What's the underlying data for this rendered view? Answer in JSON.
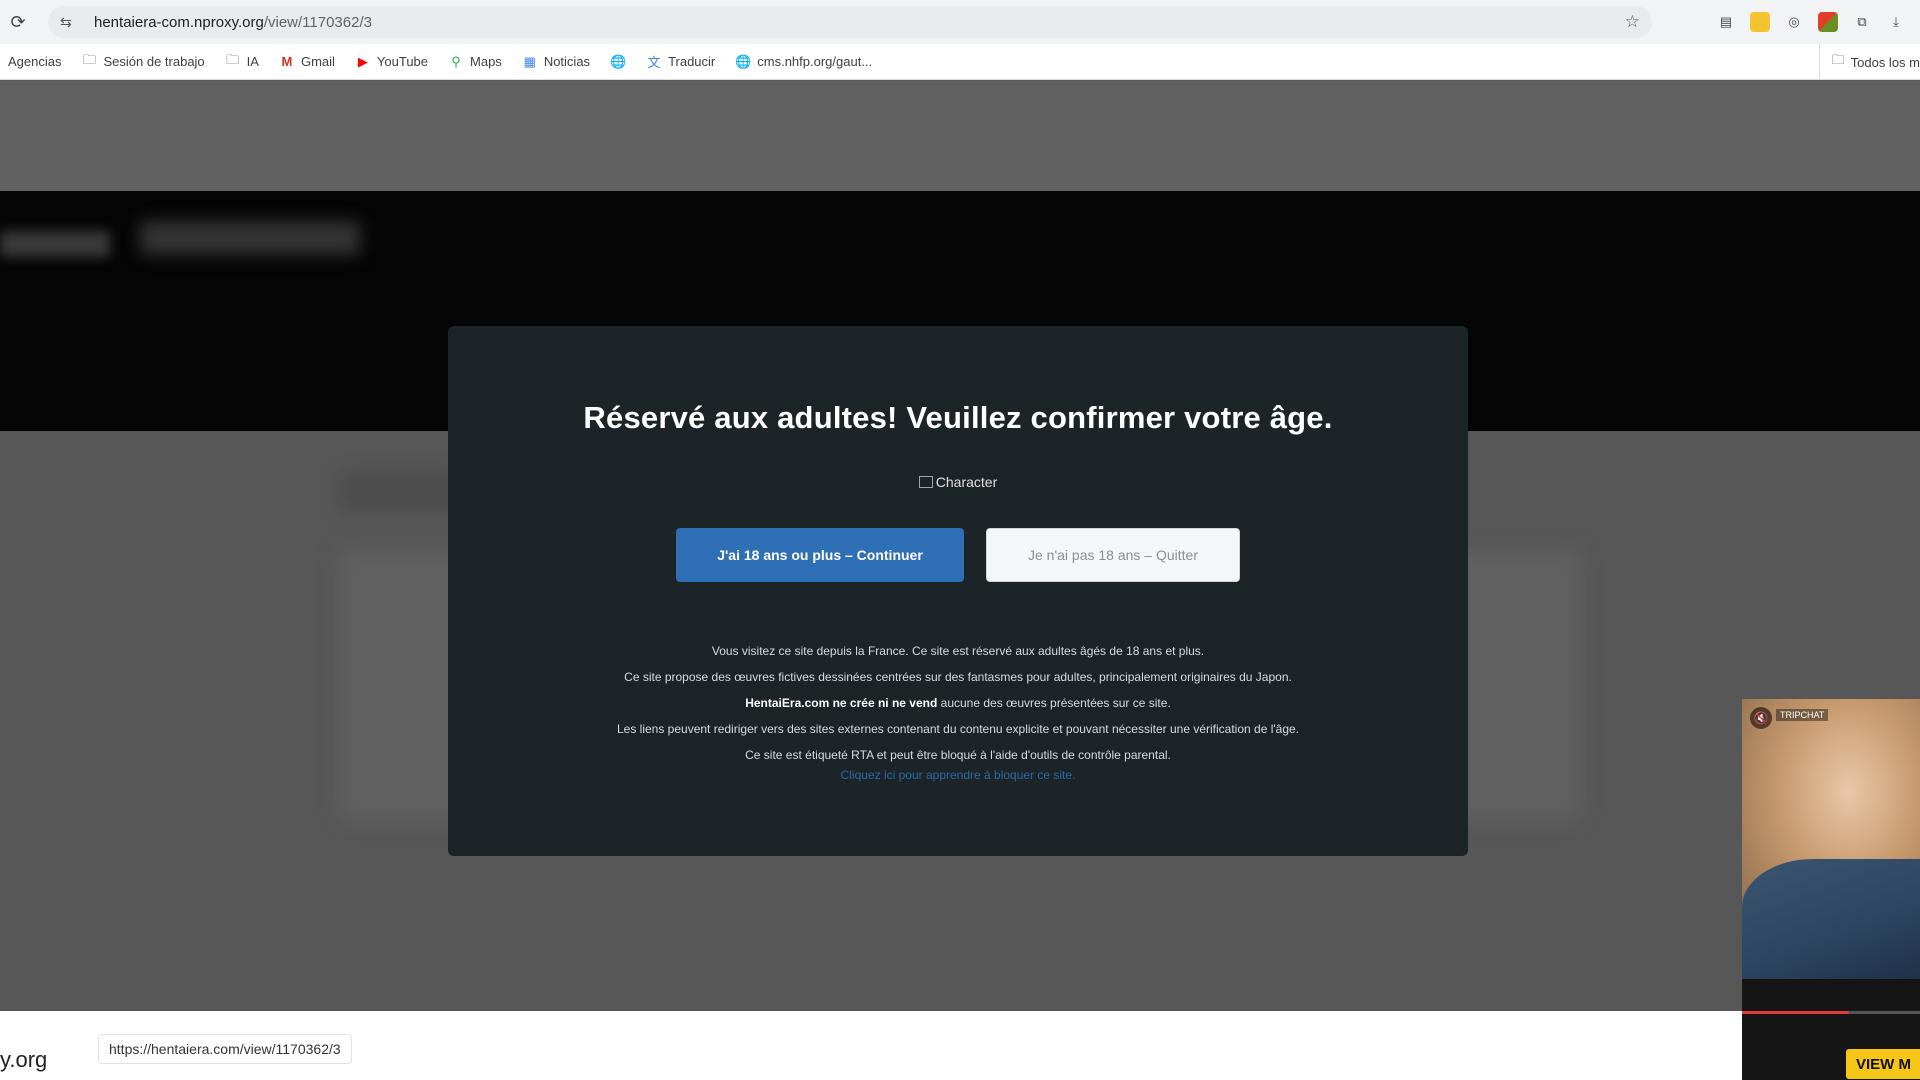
{
  "browser": {
    "url_host": "hentaiera-com.nproxy.org",
    "url_path": "/view/1170362/3",
    "bookmarks": [
      {
        "icon": "folder-icon",
        "label": "Agencias"
      },
      {
        "icon": "folder-icon",
        "label": "Sesión de trabajo"
      },
      {
        "icon": "folder-icon",
        "label": "IA"
      },
      {
        "icon": "gmail-icon",
        "label": "Gmail"
      },
      {
        "icon": "youtube-icon",
        "label": "YouTube"
      },
      {
        "icon": "maps-icon",
        "label": "Maps"
      },
      {
        "icon": "news-icon",
        "label": "Noticias"
      },
      {
        "icon": "globe-icon",
        "label": ""
      },
      {
        "icon": "translate-icon",
        "label": "Traducir"
      },
      {
        "icon": "globe-icon",
        "label": "cms.nhfp.org/gaut..."
      }
    ],
    "bookmarks_right": "Todos los m"
  },
  "modal": {
    "title": "Réservé aux adultes!  Veuillez confirmer votre âge.",
    "image_alt": "Character",
    "continue_label": "J'ai 18 ans ou plus – Continuer",
    "quit_label": "Je n'ai pas 18 ans – Quitter",
    "line1": "Vous visitez ce site depuis la France. Ce site est réservé aux adultes âgés de 18 ans et plus.",
    "line2": "Ce site propose des œuvres fictives dessinées centrées sur des fantasmes pour adultes, principalement originaires du Japon.",
    "line3_brand": "HentaiEra.com",
    "line3_bold": "ne crée ni ne vend",
    "line3_rest": "aucune des œuvres présentées sur ce site.",
    "line4": "Les liens peuvent rediriger vers des sites externes contenant du contenu explicite et pouvant nécessiter une vérification de l'âge.",
    "line5": "Ce site est étiqueté RTA et peut être bloqué à l'aide d'outils de contrôle parental.",
    "link": "Cliquez ici pour apprendre à bloquer ce site."
  },
  "ad": {
    "brand": "TRIPCHAT",
    "view_label": "VIEW M",
    "progress": 0.6
  },
  "status": {
    "domain_fragment": "y.org",
    "hover_url": "https://hentaiera.com/view/1170362/3"
  },
  "colors": {
    "modal_bg": "#1c2428",
    "continue_bg": "#2f6fb5",
    "link": "#2a6aa8",
    "view_btn": "#f5c518"
  }
}
